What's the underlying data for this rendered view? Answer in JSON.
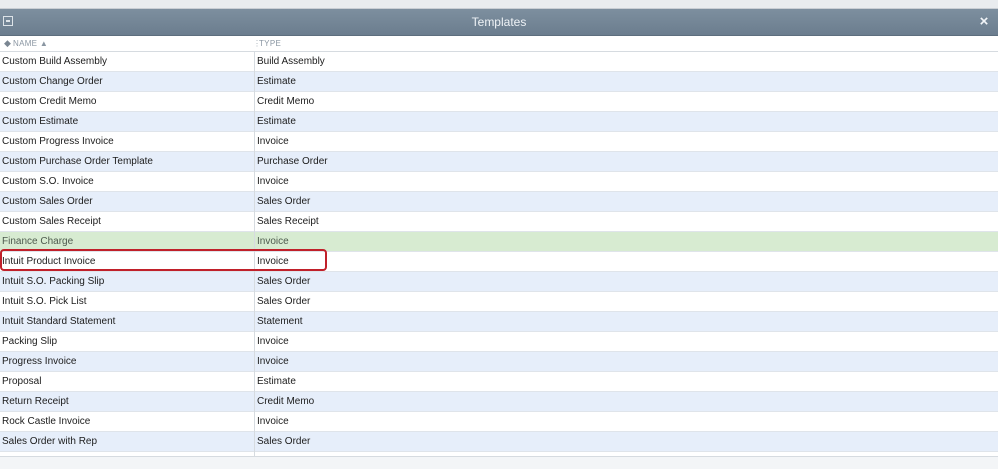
{
  "window": {
    "title": "Templates",
    "close_label": "×"
  },
  "columns": {
    "name_header": "NAME ▲",
    "type_header": "TYPE",
    "sort_icon": "diamond-sort-icon",
    "separator": "⋮"
  },
  "rows": [
    {
      "name": "Custom Build Assembly",
      "type": "Build Assembly"
    },
    {
      "name": "Custom Change Order",
      "type": "Estimate"
    },
    {
      "name": "Custom Credit Memo",
      "type": "Credit Memo"
    },
    {
      "name": "Custom Estimate",
      "type": "Estimate"
    },
    {
      "name": "Custom Progress Invoice",
      "type": "Invoice"
    },
    {
      "name": "Custom Purchase Order Template",
      "type": "Purchase Order"
    },
    {
      "name": "Custom S.O. Invoice",
      "type": "Invoice"
    },
    {
      "name": "Custom Sales Order",
      "type": "Sales Order"
    },
    {
      "name": "Custom Sales Receipt",
      "type": "Sales Receipt"
    },
    {
      "name": "Finance Charge",
      "type": "Invoice"
    },
    {
      "name": "Intuit Product Invoice",
      "type": "Invoice"
    },
    {
      "name": "Intuit S.O. Packing Slip",
      "type": "Sales Order"
    },
    {
      "name": "Intuit S.O. Pick List",
      "type": "Sales Order"
    },
    {
      "name": "Intuit Standard Statement",
      "type": "Statement"
    },
    {
      "name": "Packing Slip",
      "type": "Invoice"
    },
    {
      "name": "Progress Invoice",
      "type": "Invoice"
    },
    {
      "name": "Proposal",
      "type": "Estimate"
    },
    {
      "name": "Return Receipt",
      "type": "Credit Memo"
    },
    {
      "name": "Rock Castle Invoice",
      "type": "Invoice"
    },
    {
      "name": "Sales Order with Rep",
      "type": "Sales Order"
    }
  ],
  "selected_row_index": 9,
  "highlighted_row_index": 10,
  "colors": {
    "titlebar": "#74879a",
    "alt_row": "#e6eefa",
    "selected_row": "#d7ebd1",
    "highlight_border": "#c0202a"
  }
}
